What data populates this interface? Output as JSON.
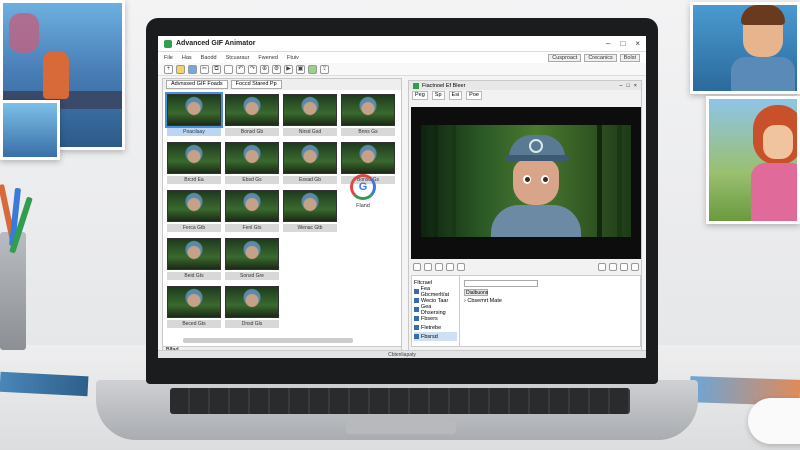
{
  "app": {
    "title": "Advanced GIF Animator"
  },
  "menu": {
    "items": [
      "File",
      "Has",
      "Baodd",
      "Stcuaraur",
      "Fwened",
      "Ftuiv"
    ],
    "right_buttons": [
      "Cusproact",
      "Crecanics",
      "Bolst"
    ]
  },
  "toolbar": {
    "icons": [
      "new-icon",
      "open-icon",
      "save-icon",
      "cut-icon",
      "copy-icon",
      "paste-icon",
      "undo-icon",
      "redo-icon",
      "zoom-icon",
      "settings-icon",
      "play-icon",
      "frame-icon",
      "image-icon",
      "export-icon"
    ]
  },
  "frames_panel": {
    "tabs": [
      "Advnssed GIF Foads",
      "Foccd Stared Pp"
    ],
    "frames": [
      {
        "label": "Poacilaay",
        "selected": true
      },
      {
        "label": "Bonsd Gb"
      },
      {
        "label": "Nirsd Gsd"
      },
      {
        "label": "Bnns Gs"
      },
      {
        "label": "Brcrd Ea"
      },
      {
        "label": "Ebsd Gs"
      },
      {
        "label": "Esvad Gb"
      },
      {
        "label": "Bonsd Gs"
      },
      {
        "label": "Ferca Gtb"
      },
      {
        "label": "Fenl Gts"
      },
      {
        "label": "Wenac Gtb"
      },
      {
        "label": "Beid Gts"
      },
      {
        "label": "Sonsd Gre"
      },
      {
        "label": "Beced Gts"
      },
      {
        "label": "Dnsd Gls"
      }
    ],
    "logo_label": "Fland",
    "status": "Blfad"
  },
  "preview_panel": {
    "title": "Fiactnoel Ef Bleer",
    "tools": [
      "Peg",
      "Sp",
      "Esi",
      "Poe"
    ],
    "props_list": [
      "Fltcrael",
      "Fea Gbcmerlt/at",
      "Wecio Taar",
      "Gea Dhsersing",
      "Fbsers",
      "Fletrebe",
      "Fbsrsd"
    ],
    "props_active": 6,
    "fields": {
      "dropdown": "Dialbuons",
      "tree_item": "Cbsemrt Mate"
    }
  },
  "statusbar": {
    "text": "Cbtenliapaty"
  }
}
